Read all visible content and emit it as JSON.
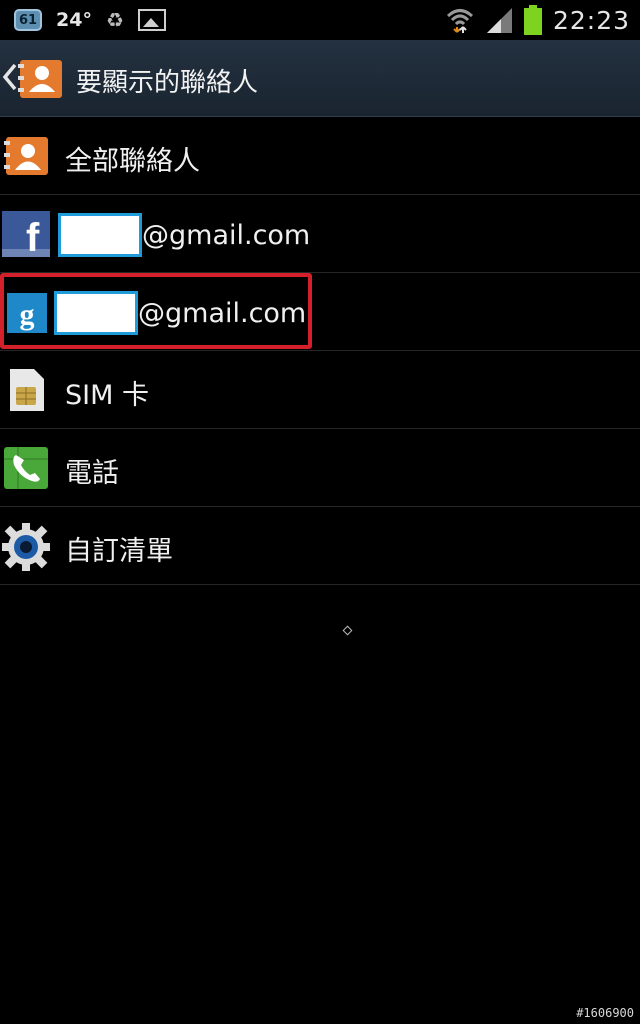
{
  "status_bar": {
    "badge": "61",
    "temperature": "24°",
    "recycle_icon": "♻",
    "clock": "22:23"
  },
  "action_bar": {
    "title": "要顯示的聯絡人"
  },
  "list": {
    "items": [
      {
        "label": "全部聯絡人",
        "icon": "contacts-icon"
      },
      {
        "label": "@gmail.com",
        "icon": "facebook-icon"
      },
      {
        "label": "@gmail.com",
        "icon": "google-icon"
      },
      {
        "label": "SIM 卡",
        "icon": "sim-card-icon"
      },
      {
        "label": "電話",
        "icon": "phone-icon"
      },
      {
        "label": "自訂清單",
        "icon": "gear-icon"
      }
    ]
  },
  "colors": {
    "highlight": "#d3202b",
    "redaction_border": "#1e9bd8",
    "action_bar": "#1f2b38"
  },
  "watermark": "#1606900"
}
